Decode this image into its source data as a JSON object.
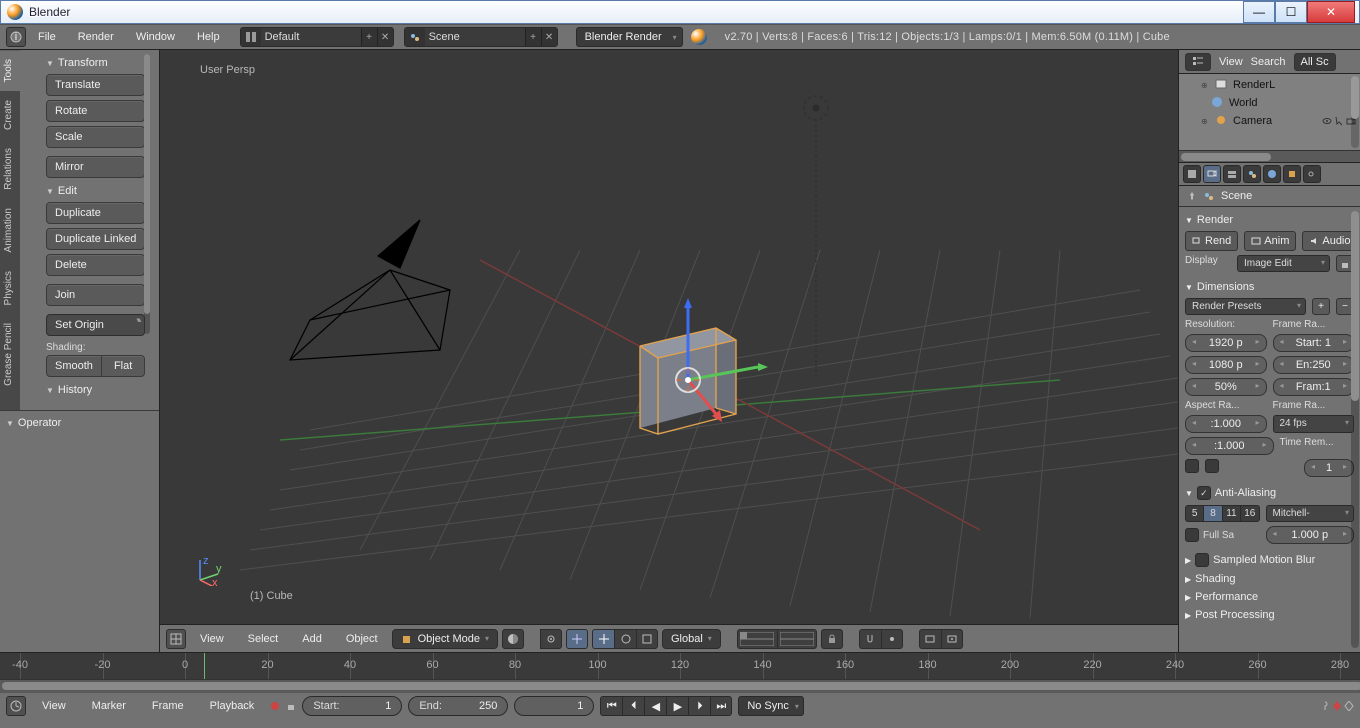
{
  "window": {
    "title": "Blender"
  },
  "winbtns": {
    "min": "—",
    "max": "☐",
    "close": "✕"
  },
  "info": {
    "menus": [
      "File",
      "Render",
      "Window",
      "Help"
    ],
    "layout": "Default",
    "scene": "Scene",
    "engine": "Blender Render",
    "stats": "v2.70 | Verts:8 | Faces:6 | Tris:12 | Objects:1/3 | Lamps:0/1 | Mem:6.50M (0.11M) | Cube"
  },
  "toolshelf": {
    "tabs": [
      "Tools",
      "Create",
      "Relations",
      "Animation",
      "Physics",
      "Grease Pencil"
    ],
    "transform": {
      "title": "Transform",
      "translate": "Translate",
      "rotate": "Rotate",
      "scale": "Scale",
      "mirror": "Mirror"
    },
    "edit": {
      "title": "Edit",
      "duplicate": "Duplicate",
      "duplicate_linked": "Duplicate Linked",
      "delete": "Delete",
      "join": "Join",
      "set_origin": "Set Origin",
      "shading_lbl": "Shading:",
      "smooth": "Smooth",
      "flat": "Flat"
    },
    "history": {
      "title": "History"
    },
    "operator": {
      "title": "Operator"
    }
  },
  "viewport": {
    "top": "User Persp",
    "bottom": "(1) Cube",
    "header": {
      "menus": [
        "View",
        "Select",
        "Add",
        "Object"
      ],
      "mode": "Object Mode",
      "orient": "Global"
    }
  },
  "timeline": {
    "ticks": [
      -40,
      -20,
      0,
      20,
      40,
      60,
      80,
      100,
      120,
      140,
      160,
      180,
      200,
      220,
      240,
      260,
      280
    ],
    "header": {
      "menus": [
        "View",
        "Marker",
        "Frame",
        "Playback"
      ],
      "start_l": "Start:",
      "start_v": "1",
      "end_l": "End:",
      "end_v": "250",
      "cur": "1",
      "sync": "No Sync"
    }
  },
  "outliner": {
    "hdr": {
      "view": "View",
      "search": "Search",
      "filter": "All Sc"
    },
    "rows": [
      "RenderL",
      "World",
      "Camera"
    ]
  },
  "props": {
    "context": "Scene",
    "render_panel": "Render",
    "render": "Rend",
    "anim": "Anim",
    "audio": "Audio",
    "display_lbl": "Display",
    "display_val": "Image Edit",
    "dimensions": "Dimensions",
    "presets": "Render Presets",
    "resolution_lbl": "Resolution:",
    "frame_range_lbl": "Frame Ra...",
    "res_x": "1920 p",
    "res_y": "1080 p",
    "res_pct": "50%",
    "fr_start": "Start: 1",
    "fr_end": "En:250",
    "fr_step": "Fram:1",
    "aspect_lbl": "Aspect Ra...",
    "frame_rate_lbl": "Frame Ra...",
    "asp_x": ":1.000",
    "asp_y": ":1.000",
    "fps": "24 fps",
    "time_rem": "Time Rem...",
    "time_num": "1",
    "aa": "Anti-Aliasing",
    "aa_5": "5",
    "aa_8": "8",
    "aa_11": "11",
    "aa_16": "16",
    "aa_filter": "Mitchell-",
    "full_sample": "Full Sa",
    "aa_size": "1.000 p",
    "smb": "Sampled Motion Blur",
    "shading": "Shading",
    "perf": "Performance",
    "post": "Post Processing"
  }
}
